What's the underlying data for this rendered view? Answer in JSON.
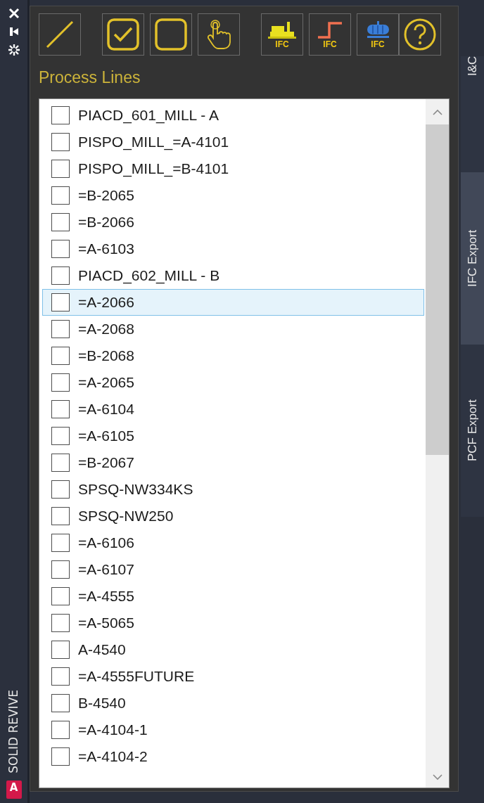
{
  "side_strip": {
    "icons": [
      {
        "kind": "close"
      },
      {
        "kind": "pin"
      },
      {
        "kind": "gear"
      }
    ],
    "brand": "SOLID REVIVE",
    "app_badge": "A"
  },
  "toolbar": [
    {
      "kind": "line"
    },
    {
      "kind": "check-all"
    },
    {
      "kind": "uncheck-all"
    },
    {
      "kind": "pick"
    },
    {
      "kind": "equipment",
      "caption": "IFC"
    },
    {
      "kind": "pipe",
      "caption": "IFC"
    },
    {
      "kind": "vessel",
      "caption": "IFC"
    },
    {
      "kind": "help"
    }
  ],
  "title": "Process Lines",
  "items": [
    {
      "label": "PIACD_601_MILL - A",
      "checked": false,
      "selected": false
    },
    {
      "label": "PISPO_MILL_=A-4101",
      "checked": false,
      "selected": false
    },
    {
      "label": "PISPO_MILL_=B-4101",
      "checked": false,
      "selected": false
    },
    {
      "label": "=B-2065",
      "checked": false,
      "selected": false
    },
    {
      "label": "=B-2066",
      "checked": false,
      "selected": false
    },
    {
      "label": "=A-6103",
      "checked": false,
      "selected": false
    },
    {
      "label": "PIACD_602_MILL - B",
      "checked": false,
      "selected": false
    },
    {
      "label": "=A-2066",
      "checked": false,
      "selected": true
    },
    {
      "label": "=A-2068",
      "checked": false,
      "selected": false
    },
    {
      "label": "=B-2068",
      "checked": false,
      "selected": false
    },
    {
      "label": "=A-2065",
      "checked": false,
      "selected": false
    },
    {
      "label": "=A-6104",
      "checked": false,
      "selected": false
    },
    {
      "label": "=A-6105",
      "checked": false,
      "selected": false
    },
    {
      "label": "=B-2067",
      "checked": false,
      "selected": false
    },
    {
      "label": "SPSQ-NW334KS",
      "checked": false,
      "selected": false
    },
    {
      "label": "SPSQ-NW250",
      "checked": false,
      "selected": false
    },
    {
      "label": "=A-6106",
      "checked": false,
      "selected": false
    },
    {
      "label": "=A-6107",
      "checked": false,
      "selected": false
    },
    {
      "label": "=A-4555",
      "checked": false,
      "selected": false
    },
    {
      "label": "=A-5065",
      "checked": false,
      "selected": false
    },
    {
      "label": "A-4540",
      "checked": false,
      "selected": false
    },
    {
      "label": "=A-4555FUTURE",
      "checked": false,
      "selected": false
    },
    {
      "label": "B-4540",
      "checked": false,
      "selected": false
    },
    {
      "label": "=A-4104-1",
      "checked": false,
      "selected": false
    },
    {
      "label": "=A-4104-2",
      "checked": false,
      "selected": false
    }
  ],
  "tabs": [
    {
      "label": "I&C",
      "selected": false
    },
    {
      "label": "IFC Export",
      "selected": true
    },
    {
      "label": "PCF Export",
      "selected": false
    }
  ]
}
